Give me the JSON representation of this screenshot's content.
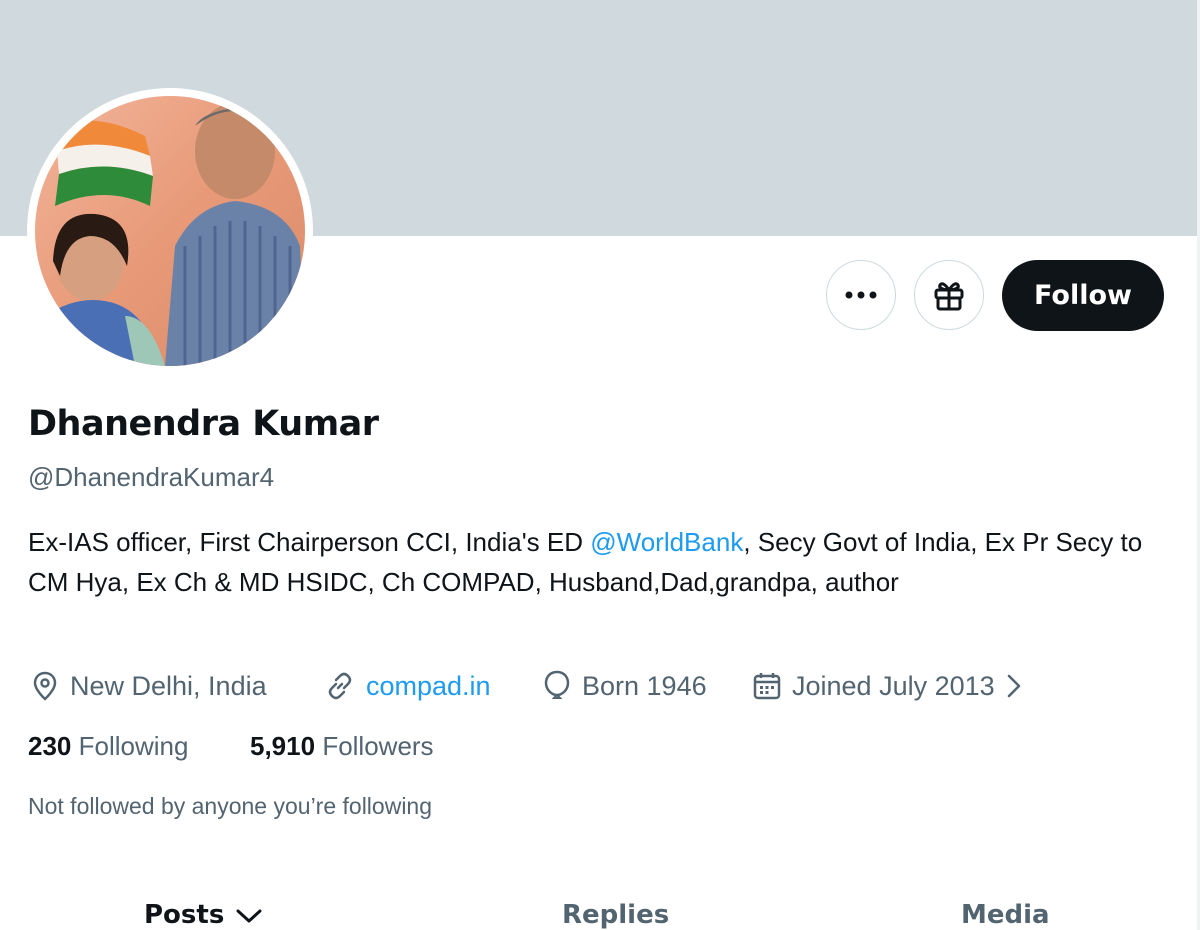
{
  "profile": {
    "name": "Dhanendra Kumar",
    "handle": "@DhanendraKumar4",
    "bio_part1": "Ex-IAS officer, First Chairperson CCI, India's ED ",
    "bio_mention": "@WorldBank",
    "bio_part2": ", Secy Govt of India, Ex Pr Secy to CM Hya, Ex Ch & MD HSIDC, Ch COMPAD, Husband,Dad,grandpa, author",
    "location": "New Delhi, India",
    "website": "compad.in",
    "born": "Born 1946",
    "joined": "Joined July 2013"
  },
  "actions": {
    "follow_label": "Follow",
    "more_icon": "more-icon",
    "gift_icon": "gift-icon"
  },
  "stats": {
    "following_count": "230",
    "following_label": "Following",
    "followers_count": "5,910",
    "followers_label": "Followers"
  },
  "social_context": "Not followed by anyone you’re following",
  "tabs": [
    {
      "label": "Posts"
    },
    {
      "label": "Replies"
    },
    {
      "label": "Media"
    }
  ],
  "colors": {
    "banner": "#cfd9de",
    "accent": "#1d9bf0",
    "secondary_text": "#536471",
    "primary_text": "#0f1419"
  }
}
